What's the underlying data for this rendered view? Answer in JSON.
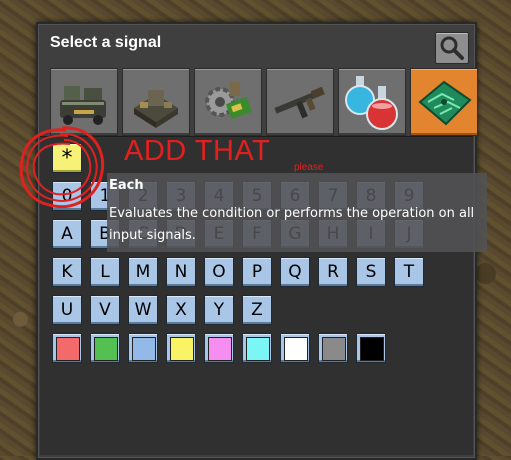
{
  "dialog": {
    "title": "Select a signal",
    "search_icon": "magnifier-icon"
  },
  "tabs": [
    {
      "name": "logistics",
      "icon": "logistics-icon",
      "selected": false
    },
    {
      "name": "production",
      "icon": "assembler-icon",
      "selected": false
    },
    {
      "name": "intermediate-products",
      "icon": "gear-circuit-icon",
      "selected": false
    },
    {
      "name": "combat",
      "icon": "rifle-icon",
      "selected": false
    },
    {
      "name": "science",
      "icon": "flasks-icon",
      "selected": false
    },
    {
      "name": "signals",
      "icon": "circuit-board-icon",
      "selected": true
    }
  ],
  "signals": {
    "each": "*",
    "hidden_row": [
      "0",
      "1",
      "2",
      "3",
      "4",
      "5",
      "6",
      "7",
      "8",
      "9"
    ],
    "letters_row1": [
      "A",
      "B",
      "C",
      "D",
      "E",
      "F",
      "G",
      "H",
      "I",
      "J"
    ],
    "letters_row2": [
      "K",
      "L",
      "M",
      "N",
      "O",
      "P",
      "Q",
      "R",
      "S",
      "T"
    ],
    "letters_row3": [
      "U",
      "V",
      "W",
      "X",
      "Y",
      "Z"
    ],
    "colors": [
      {
        "name": "red",
        "hex": "#f26a6a"
      },
      {
        "name": "green",
        "hex": "#55c052"
      },
      {
        "name": "blue",
        "hex": "#93b9e9"
      },
      {
        "name": "yellow",
        "hex": "#f9f465"
      },
      {
        "name": "pink",
        "hex": "#f68ef1"
      },
      {
        "name": "cyan",
        "hex": "#7cf5f6"
      },
      {
        "name": "white",
        "hex": "#ffffff"
      },
      {
        "name": "grey",
        "hex": "#8a8a8a"
      },
      {
        "name": "black",
        "hex": "#000000"
      }
    ]
  },
  "tooltip": {
    "title": "Each",
    "description": "Evaluates the condition or performs the operation on all input signals."
  },
  "annotation": {
    "main": "ADD THAT",
    "small": "please",
    "color": "#e0211f"
  }
}
